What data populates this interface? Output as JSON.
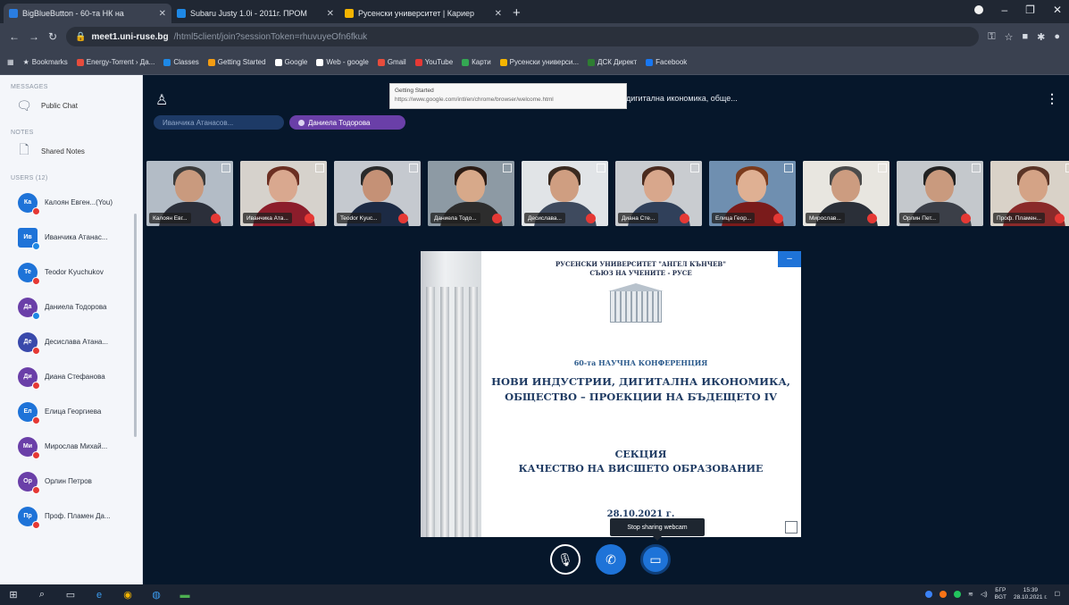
{
  "browser": {
    "tabs": [
      {
        "title": "BigBlueButton - 60-та НК на",
        "active": true,
        "fav_color": "#2a7de1"
      },
      {
        "title": "Subaru Justy 1.0i - 2011г. ПРОМ",
        "active": false,
        "fav_color": "#1e88e5"
      },
      {
        "title": "Русенски университет | Кариер",
        "active": false,
        "fav_color": "#f4b400"
      }
    ],
    "new_tab": "+",
    "url_host": "meet1.uni-ruse.bg",
    "url_path": "/html5client/join?sessionToken=rhuvuyeOfn6fkuk",
    "bookmarks_label": "Bookmarks",
    "bookmarks": [
      {
        "label": "Energy-Torrent › Да...",
        "color": "#e74c3c"
      },
      {
        "label": "Classes",
        "color": "#1e88e5"
      },
      {
        "label": "Getting Started",
        "color": "#f39c12"
      },
      {
        "label": "Google",
        "color": "#ffffff"
      },
      {
        "label": "Web - google",
        "color": "#ffffff"
      },
      {
        "label": "Gmail",
        "color": "#e74c3c"
      },
      {
        "label": "YouTube",
        "color": "#e53935"
      },
      {
        "label": "Карти",
        "color": "#34a853"
      },
      {
        "label": "Русенски универси...",
        "color": "#f4b400"
      },
      {
        "label": "ДСК Директ",
        "color": "#2e7d32"
      },
      {
        "label": "Facebook",
        "color": "#1877f2"
      }
    ]
  },
  "sidebar": {
    "messages_title": "MESSAGES",
    "public_chat": "Public Chat",
    "notes_title": "NOTES",
    "shared_notes": "Shared Notes",
    "users_title": "USERS (12)",
    "users": [
      {
        "initials": "Ка",
        "name": "Калоян Евген...(You)",
        "color": "#1e73d8",
        "status": "red",
        "square": false
      },
      {
        "initials": "Ив",
        "name": "Иванчика Атанас...",
        "color": "#1e73d8",
        "status": "blue",
        "square": true
      },
      {
        "initials": "Те",
        "name": "Teodor Kyuchukov",
        "color": "#1e73d8",
        "status": "red",
        "square": false
      },
      {
        "initials": "Да",
        "name": "Даниела Тодорова",
        "color": "#6a3fa8",
        "status": "blue",
        "square": false
      },
      {
        "initials": "Де",
        "name": "Десислава Атана...",
        "color": "#3949ab",
        "status": "red",
        "square": false
      },
      {
        "initials": "Ди",
        "name": "Диана Стефанова",
        "color": "#6a3fa8",
        "status": "red",
        "square": false
      },
      {
        "initials": "Ел",
        "name": "Елица Георгиева",
        "color": "#1e73d8",
        "status": "red",
        "square": false
      },
      {
        "initials": "Ми",
        "name": "Мирослав Михай...",
        "color": "#6a3fa8",
        "status": "red",
        "square": false
      },
      {
        "initials": "Ор",
        "name": "Орлин Петров",
        "color": "#6a3fa8",
        "status": "red",
        "square": false
      },
      {
        "initials": "Пр",
        "name": "Проф. Пламен Да...",
        "color": "#1e73d8",
        "status": "red",
        "square": false
      }
    ]
  },
  "meeting": {
    "title": "дигитална икономика, обще...",
    "tooltip_title": "Getting Started",
    "tooltip_url": "https://www.google.com/intl/en/chrome/browser/welcome.html",
    "talkers": [
      "Иванчика Атанасов...",
      "Даниела Тодорова"
    ]
  },
  "webcams": [
    {
      "name": "Калоян Евг...",
      "bg": "#b3bcc6",
      "skin": "#c99a7e",
      "hair": "#3b3b3b",
      "shirt": "#2b2f3a"
    },
    {
      "name": "Иванчика Ата...",
      "bg": "#d6d2cc",
      "skin": "#d9a88f",
      "hair": "#6b2f22",
      "shirt": "#8c1d2b"
    },
    {
      "name": "Teodor Kyuc...",
      "bg": "#c5c9cf",
      "skin": "#c59176",
      "hair": "#2a2a2a",
      "shirt": "#1c2a44"
    },
    {
      "name": "Даниела Тодо...",
      "bg": "#8d9aa4",
      "skin": "#d7a98a",
      "hair": "#2b1b14",
      "shirt": "#2d2d2d"
    },
    {
      "name": "Десислава...",
      "bg": "#e1e4e7",
      "skin": "#cf9e81",
      "hair": "#3a2a20",
      "shirt": "#3e4a5e"
    },
    {
      "name": "Диана Сте...",
      "bg": "#c9ccd0",
      "skin": "#d8a78c",
      "hair": "#4a2a1e",
      "shirt": "#30405a"
    },
    {
      "name": "Елица Геор...",
      "bg": "#6f8fb0",
      "skin": "#dfb093",
      "hair": "#7a3a1c",
      "shirt": "#7a1b1b"
    },
    {
      "name": "Мирослав...",
      "bg": "#e8e6e0",
      "skin": "#cc9c80",
      "hair": "#4a4a4a",
      "shirt": "#2a2f38"
    },
    {
      "name": "Орлин Пет...",
      "bg": "#c4c8cc",
      "skin": "#c99a7e",
      "hair": "#222222",
      "shirt": "#3b3f48"
    },
    {
      "name": "Проф. Пламен...",
      "bg": "#d9d2c8",
      "skin": "#d4a386",
      "hair": "#5a3426",
      "shirt": "#8a2a2a"
    }
  ],
  "slide": {
    "header1": "РУСЕНСКИ УНИВЕРСИТЕТ \"АНГЕЛ КЪНЧЕВ\"",
    "header2": "СЪЮЗ НА УЧЕНИТЕ - РУСЕ",
    "conference": "60-та НАУЧНА КОНФЕРЕНЦИЯ",
    "theme": "НОВИ ИНДУСТРИИ, ДИГИТАЛНА ИКОНОМИКА, ОБЩЕСТВО – ПРОЕКЦИИ НА БЪДЕЩЕТО IV",
    "section_label": "СЕКЦИЯ",
    "section_name": "КАЧЕСТВО НА ВИСШЕТО ОБРАЗОВАНИЕ",
    "date": "28.10.2021 г."
  },
  "controls": {
    "tooltip": "Stop sharing webcam"
  },
  "taskbar": {
    "lang": "БГР",
    "lang2": "BGT",
    "time": "15:39",
    "date": "28.10.2021 г."
  }
}
